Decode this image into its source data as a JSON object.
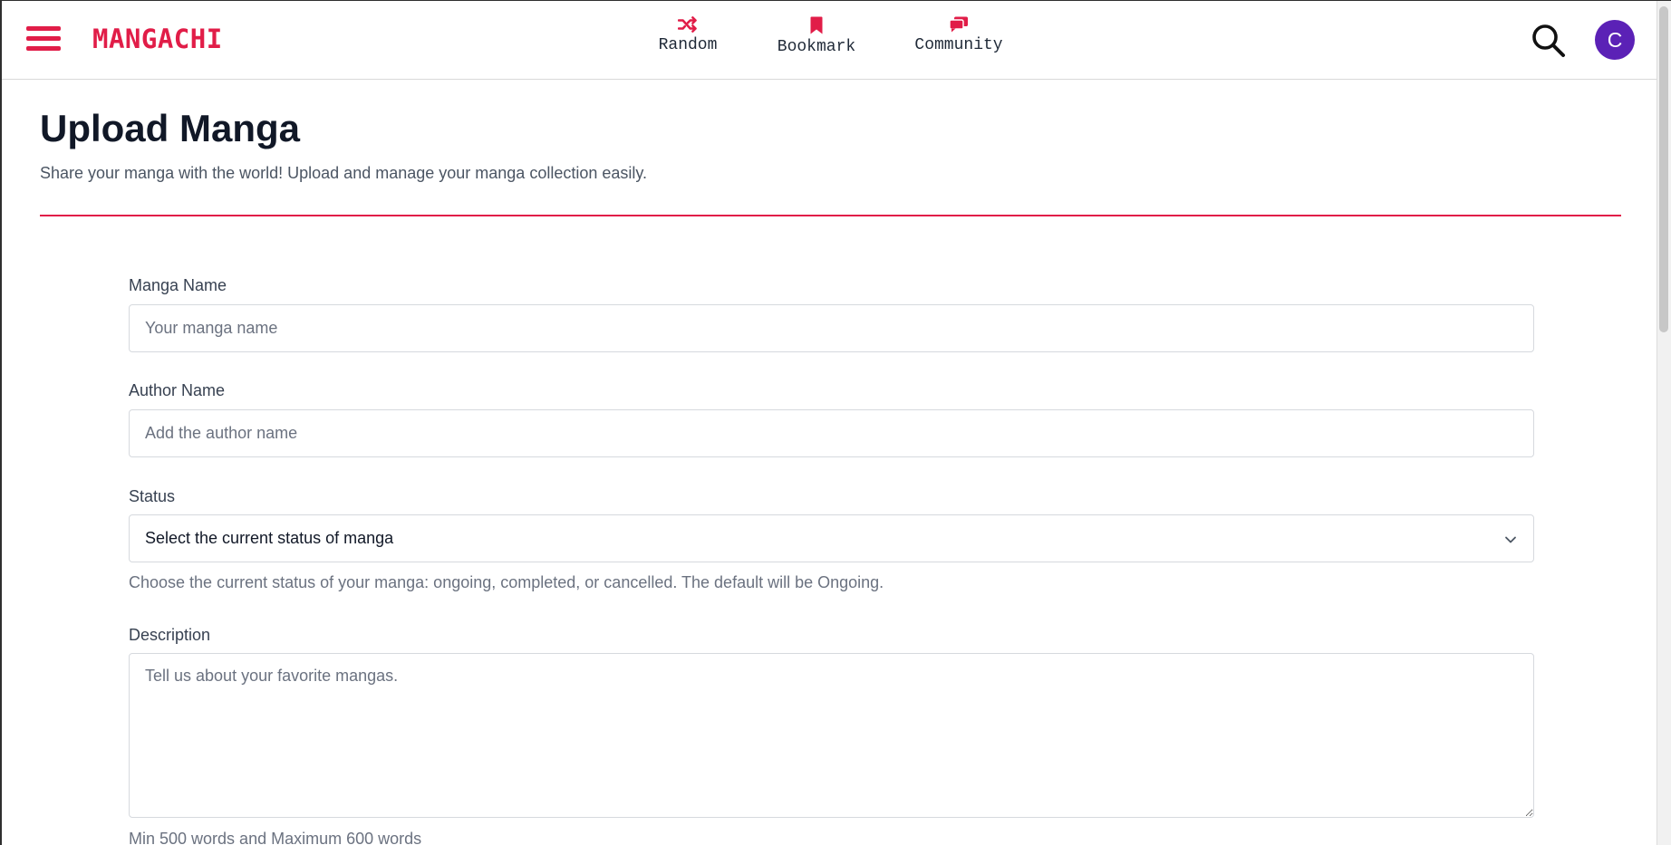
{
  "header": {
    "brand": "MANGACHI",
    "brand_color": "#e11d48",
    "menu_icon": "hamburger-menu-icon",
    "nav": [
      {
        "label": "Random",
        "icon": "shuffle-icon"
      },
      {
        "label": "Bookmark",
        "icon": "bookmark-icon"
      },
      {
        "label": "Community",
        "icon": "chat-icon"
      }
    ],
    "search_icon": "search-icon",
    "avatar_initial": "C",
    "avatar_color": "#5b21b6"
  },
  "page": {
    "title": "Upload Manga",
    "subtitle": "Share your manga with the world! Upload and manage your manga collection easily."
  },
  "form": {
    "manga_name": {
      "label": "Manga Name",
      "value": "",
      "placeholder": "Your manga name"
    },
    "author_name": {
      "label": "Author Name",
      "value": "",
      "placeholder": "Add the author name"
    },
    "status": {
      "label": "Status",
      "selected": "Select the current status of manga",
      "help": "Choose the current status of your manga: ongoing, completed, or cancelled. The default will be Ongoing."
    },
    "description": {
      "label": "Description",
      "value": "",
      "placeholder": "Tell us about your favorite mangas.",
      "help": "Min 500 words and Maximum 600 words"
    }
  }
}
